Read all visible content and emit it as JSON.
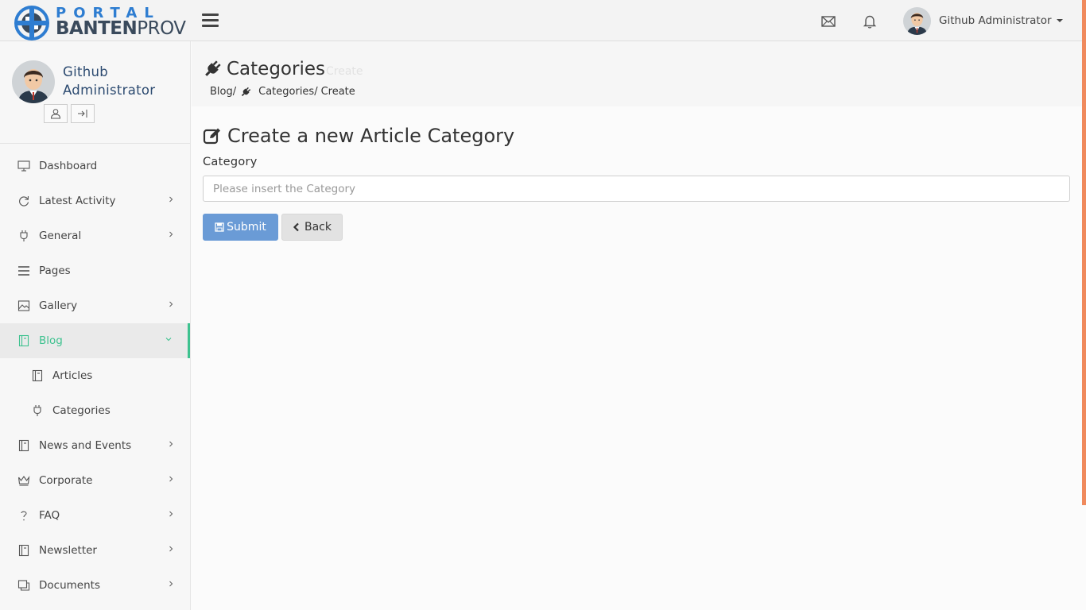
{
  "brand": {
    "top": "PORTAL",
    "bottom_bold": "BANTEN",
    "bottom_light": "PROV",
    "primary_color": "#2e7dd1",
    "dark_color": "#3a4a5c"
  },
  "topbar": {
    "user_name": "Github Administrator",
    "mail_icon": "envelope",
    "bell_icon": "bell"
  },
  "sidebar": {
    "profile_name": "Github Administrator",
    "items": [
      {
        "label": "Dashboard",
        "icon": "monitor-icon",
        "has_children": false
      },
      {
        "label": "Latest Activity",
        "icon": "refresh-icon",
        "has_children": true
      },
      {
        "label": "General",
        "icon": "plug-icon",
        "has_children": true
      },
      {
        "label": "Pages",
        "icon": "menu-icon",
        "has_children": false
      },
      {
        "label": "Gallery",
        "icon": "picture-icon",
        "has_children": true
      },
      {
        "label": "Blog",
        "icon": "book-icon",
        "has_children": true,
        "active": true
      },
      {
        "label": "Articles",
        "icon": "book-icon",
        "sub": true
      },
      {
        "label": "Categories",
        "icon": "plug-icon",
        "sub": true
      },
      {
        "label": "News and Events",
        "icon": "book-icon",
        "has_children": true
      },
      {
        "label": "Corporate",
        "icon": "crown-icon",
        "has_children": true
      },
      {
        "label": "FAQ",
        "icon": "question-icon",
        "has_children": true
      },
      {
        "label": "Newsletter",
        "icon": "book-icon",
        "has_children": true
      },
      {
        "label": "Documents",
        "icon": "copy-icon",
        "has_children": true
      }
    ],
    "active_color": "#3ec28f"
  },
  "header": {
    "title": "Categories",
    "subtitle": "Create",
    "breadcrumb": {
      "blog": "Blog/",
      "categories": "Categories/",
      "create": "Create"
    }
  },
  "form": {
    "title": "Create a new Article Category",
    "label": "Category",
    "placeholder": "Please insert the Category",
    "value": "",
    "submit_label": "Submit",
    "back_label": "Back"
  }
}
